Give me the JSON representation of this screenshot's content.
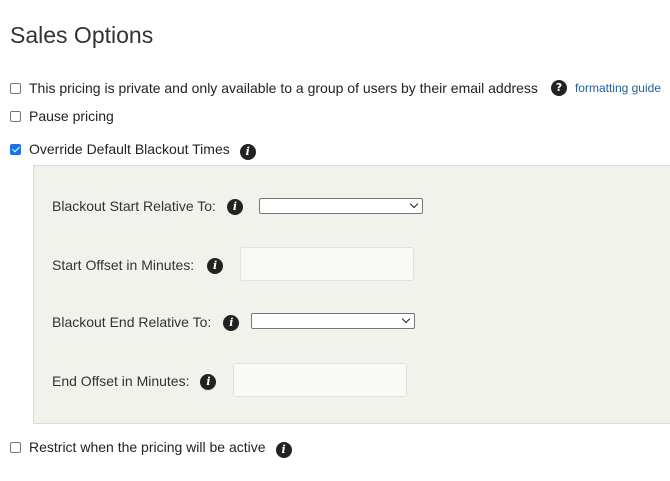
{
  "page": {
    "title": "Sales Options"
  },
  "options": {
    "private_pricing": {
      "label": "This pricing is private and only available to a group of users by their email address",
      "checked": false,
      "help_icon": "question-circle-icon",
      "link": "formatting guide"
    },
    "pause_pricing": {
      "label": "Pause pricing",
      "checked": false
    },
    "override_blackout": {
      "label": "Override Default Blackout Times",
      "checked": true,
      "info_icon": "info-circle-icon"
    },
    "restrict_active": {
      "label": "Restrict when the pricing will be active",
      "checked": false,
      "info_icon": "info-circle-icon"
    }
  },
  "blackout": {
    "start_relative_label": "Blackout Start Relative To:",
    "start_relative_value": "",
    "start_offset_label": "Start Offset in Minutes:",
    "start_offset_value": "",
    "end_relative_label": "Blackout End Relative To:",
    "end_relative_value": "",
    "end_offset_label": "End Offset in Minutes:",
    "end_offset_value": ""
  },
  "icons": {
    "info_glyph": "i",
    "help_glyph": "?"
  },
  "colors": {
    "link": "#1d5f9f",
    "checkbox_checked": "#1a73e8",
    "panel_background": "#f2f2ec",
    "icon_background": "#222222"
  }
}
